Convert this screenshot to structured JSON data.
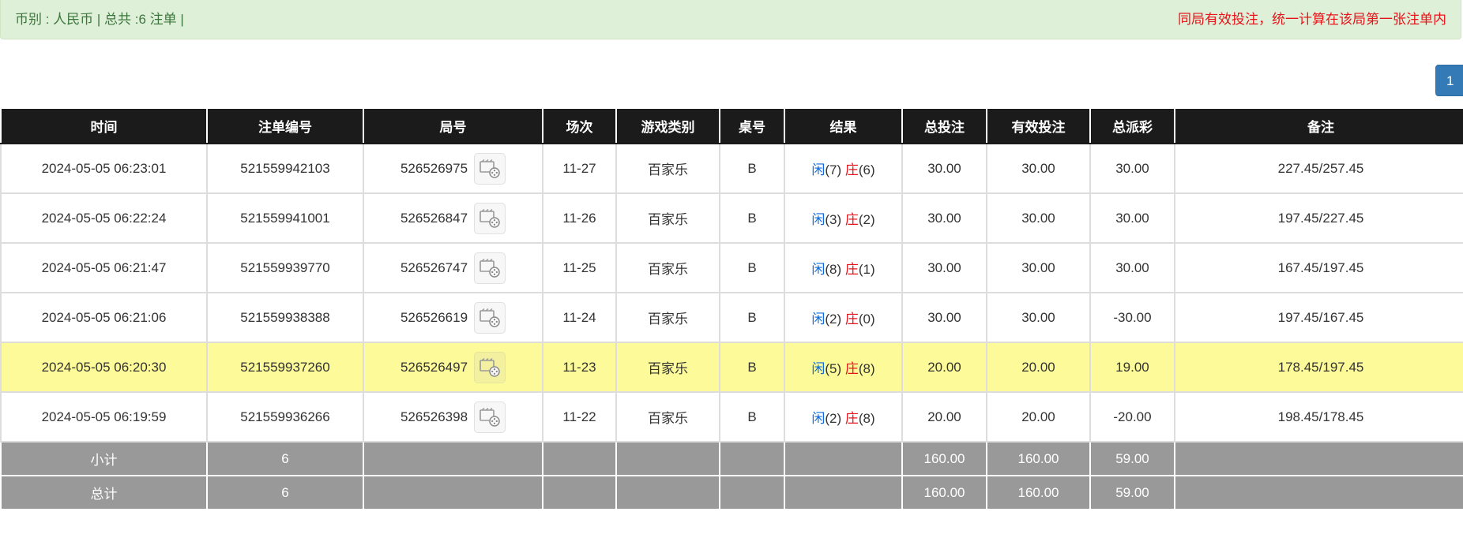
{
  "summary_bar": {
    "left_text": "币别 : 人民币 | 总共 :6 注单 |",
    "right_text": "同局有效投注，统一计算在该局第一张注单内"
  },
  "pagination": {
    "current_page": "1"
  },
  "colors": {
    "header_bg": "#1b1b1b",
    "highlight_row": "#fdfb99",
    "footer_bg": "#999999",
    "blue": "#0b6bdc",
    "red": "#e8121a",
    "alert_bg": "#dff0d8"
  },
  "table": {
    "headers": [
      "时间",
      "注单编号",
      "局号",
      "场次",
      "游戏类别",
      "桌号",
      "结果",
      "总投注",
      "有效投注",
      "总派彩",
      "备注"
    ],
    "rows": [
      {
        "time": "2024-05-05 06:23:01",
        "bet_id": "521559942103",
        "round": "526526975",
        "session": "11-27",
        "game": "百家乐",
        "table": "B",
        "player_label": "闲",
        "player_score": "(7)",
        "banker_label": "庄",
        "banker_score": "(6)",
        "total_bet": "30.00",
        "valid_bet": "30.00",
        "payout": "30.00",
        "payout_negative": false,
        "note": "227.45/257.45",
        "highlight": false
      },
      {
        "time": "2024-05-05 06:22:24",
        "bet_id": "521559941001",
        "round": "526526847",
        "session": "11-26",
        "game": "百家乐",
        "table": "B",
        "player_label": "闲",
        "player_score": "(3)",
        "banker_label": "庄",
        "banker_score": "(2)",
        "total_bet": "30.00",
        "valid_bet": "30.00",
        "payout": "30.00",
        "payout_negative": false,
        "note": "197.45/227.45",
        "highlight": false
      },
      {
        "time": "2024-05-05 06:21:47",
        "bet_id": "521559939770",
        "round": "526526747",
        "session": "11-25",
        "game": "百家乐",
        "table": "B",
        "player_label": "闲",
        "player_score": "(8)",
        "banker_label": "庄",
        "banker_score": "(1)",
        "total_bet": "30.00",
        "valid_bet": "30.00",
        "payout": "30.00",
        "payout_negative": false,
        "note": "167.45/197.45",
        "highlight": false
      },
      {
        "time": "2024-05-05 06:21:06",
        "bet_id": "521559938388",
        "round": "526526619",
        "session": "11-24",
        "game": "百家乐",
        "table": "B",
        "player_label": "闲",
        "player_score": "(2)",
        "banker_label": "庄",
        "banker_score": "(0)",
        "total_bet": "30.00",
        "valid_bet": "30.00",
        "payout": "-30.00",
        "payout_negative": true,
        "note": "197.45/167.45",
        "highlight": false
      },
      {
        "time": "2024-05-05 06:20:30",
        "bet_id": "521559937260",
        "round": "526526497",
        "session": "11-23",
        "game": "百家乐",
        "table": "B",
        "player_label": "闲",
        "player_score": "(5)",
        "banker_label": "庄",
        "banker_score": "(8)",
        "total_bet": "20.00",
        "valid_bet": "20.00",
        "payout": "19.00",
        "payout_negative": false,
        "note": "178.45/197.45",
        "highlight": true
      },
      {
        "time": "2024-05-05 06:19:59",
        "bet_id": "521559936266",
        "round": "526526398",
        "session": "11-22",
        "game": "百家乐",
        "table": "B",
        "player_label": "闲",
        "player_score": "(2)",
        "banker_label": "庄",
        "banker_score": "(8)",
        "total_bet": "20.00",
        "valid_bet": "20.00",
        "payout": "-20.00",
        "payout_negative": true,
        "note": "198.45/178.45",
        "highlight": false
      }
    ],
    "subtotal": {
      "label": "小计",
      "count": "6",
      "total_bet": "160.00",
      "valid_bet": "160.00",
      "payout": "59.00"
    },
    "total": {
      "label": "总计",
      "count": "6",
      "total_bet": "160.00",
      "valid_bet": "160.00",
      "payout": "59.00"
    }
  }
}
